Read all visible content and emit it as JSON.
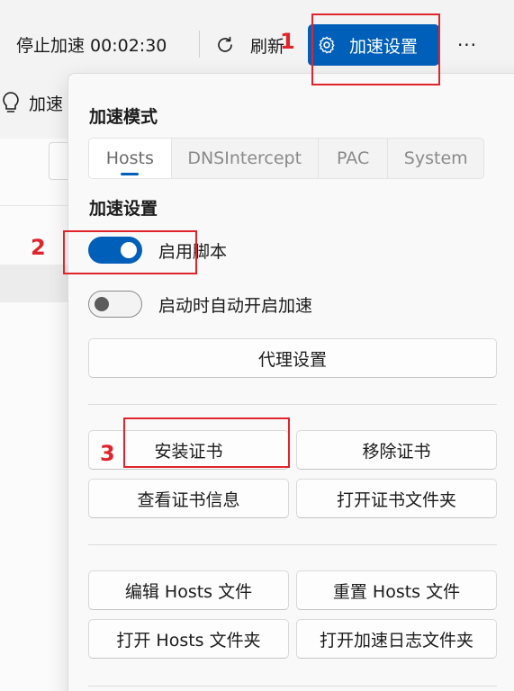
{
  "toolbar": {
    "stop_label": "停止加速 00:02:30",
    "refresh_label": "刷新",
    "accel_settings_label": "加速设置",
    "more_label": "···"
  },
  "background": {
    "hint_label": "加速"
  },
  "flyout": {
    "mode_title": "加速模式",
    "mode_tabs": [
      "Hosts",
      "DNSIntercept",
      "PAC",
      "System"
    ],
    "active_mode": "Hosts",
    "settings_title": "加速设置",
    "toggles": [
      {
        "label": "启用脚本",
        "on": true
      },
      {
        "label": "启动时自动开启加速",
        "on": false
      }
    ],
    "proxy_settings_label": "代理设置",
    "cert_buttons": {
      "install": "安装证书",
      "remove": "移除证书",
      "view_info": "查看证书信息",
      "open_folder": "打开证书文件夹"
    },
    "hosts_buttons": {
      "edit": "编辑 Hosts 文件",
      "reset": "重置 Hosts 文件",
      "open_folder": "打开 Hosts 文件夹",
      "open_log_folder": "打开加速日志文件夹"
    }
  },
  "annotations": [
    "1",
    "2",
    "3"
  ],
  "colors": {
    "accent": "#005fb8",
    "annotation": "#e0242b"
  }
}
